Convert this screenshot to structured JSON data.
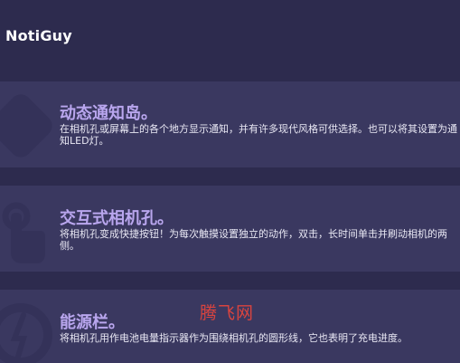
{
  "app": {
    "title": "NotiGuy"
  },
  "features": [
    {
      "title": "动态通知岛。",
      "description": "在相机孔或屏幕上的各个地方显示通知，并有许多现代风格可供选择。也可以将其设置为通知LED灯。",
      "icon": "diamond-icon"
    },
    {
      "title": "交互式相机孔。",
      "description": "将相机孔变成快捷按钮！为每次触摸设置独立的动作，双击，长时间单击并刷动相机的两侧。",
      "icon": "tap-gesture-icon"
    },
    {
      "title": "能源栏。",
      "description": "将相机孔用作电池电量指示器作为围绕相机孔的圆形线，它也表明了充电进度。",
      "icon": "battery-ring-icon"
    }
  ],
  "watermark": {
    "text": "腾飞网"
  },
  "colors": {
    "background": "#2d2b4e",
    "card": "#3a3860",
    "accent": "#b9a6ee",
    "watermark": "#d9443f"
  }
}
